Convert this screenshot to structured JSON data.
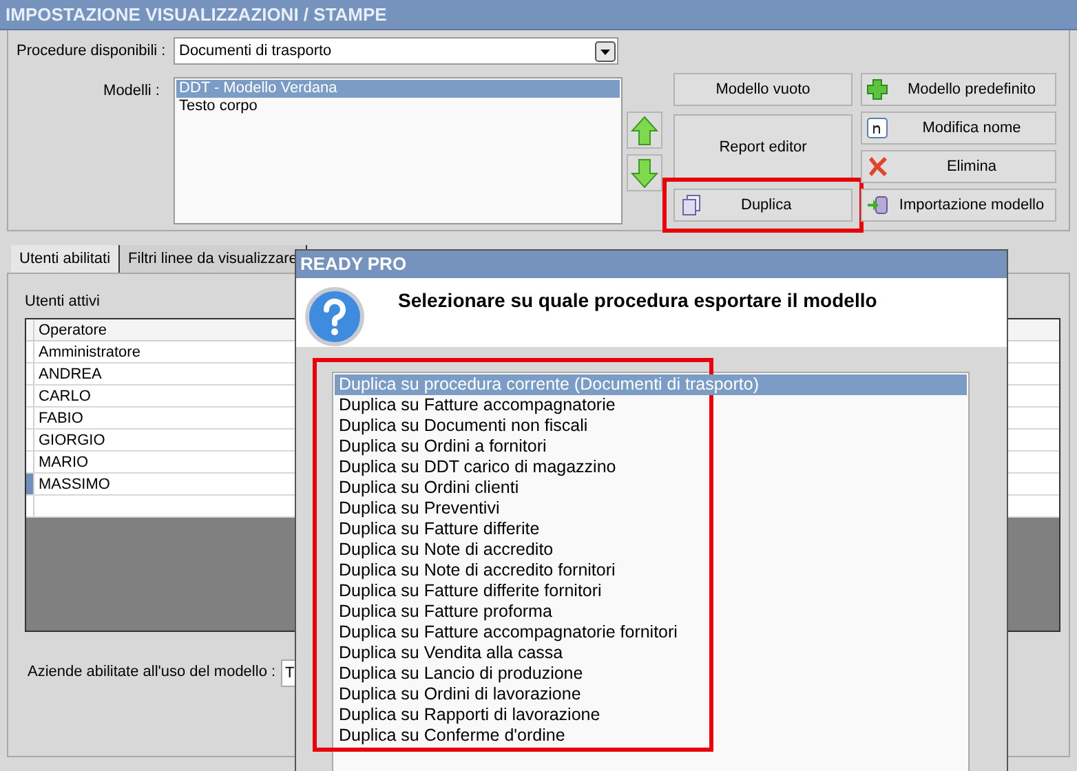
{
  "window": {
    "title": "IMPOSTAZIONE VISUALIZZAZIONI / STAMPE"
  },
  "procedure": {
    "label": "Procedure disponibili :",
    "value": "Documenti di trasporto"
  },
  "models": {
    "label": "Modelli :",
    "items": [
      {
        "text": "DDT - Modello Verdana",
        "selected": true
      },
      {
        "text": "Testo corpo",
        "selected": false
      }
    ]
  },
  "left_buttons": [
    {
      "label": "Modello vuoto",
      "kind": "plain"
    },
    {
      "label": "Report editor",
      "kind": "tall"
    },
    {
      "label": "Duplica",
      "kind": "duplicate"
    }
  ],
  "right_buttons": [
    {
      "label": "Modello predefinito",
      "kind": "add"
    },
    {
      "label": "Modifica nome",
      "kind": "rename"
    },
    {
      "label": "Elimina",
      "kind": "delete"
    },
    {
      "label": "Importazione modello",
      "kind": "import"
    }
  ],
  "tabs": [
    {
      "label": "Utenti abilitati",
      "selected": true
    },
    {
      "label": "Filtri linee da visualizzare",
      "selected": false
    }
  ],
  "users": {
    "label": "Utenti attivi",
    "column": "Operatore",
    "rows": [
      {
        "name": "Amministratore",
        "selected": false
      },
      {
        "name": "ANDREA",
        "selected": false
      },
      {
        "name": "CARLO",
        "selected": false
      },
      {
        "name": "FABIO",
        "selected": false
      },
      {
        "name": "GIORGIO",
        "selected": false
      },
      {
        "name": "MARIO",
        "selected": false
      },
      {
        "name": "MASSIMO",
        "selected": true
      }
    ]
  },
  "companies": {
    "label": "Aziende abilitate all'uso del modello :",
    "value": "T"
  },
  "dialog": {
    "title": "READY PRO",
    "message": "Selezionare su quale procedura esportare il modello",
    "options": [
      {
        "text": "Duplica su procedura corrente (Documenti di trasporto)",
        "selected": true
      },
      {
        "text": "Duplica su Fatture accompagnatorie",
        "selected": false
      },
      {
        "text": "Duplica su Documenti non fiscali",
        "selected": false
      },
      {
        "text": "Duplica su Ordini a fornitori",
        "selected": false
      },
      {
        "text": "Duplica su DDT carico di magazzino",
        "selected": false
      },
      {
        "text": "Duplica su Ordini clienti",
        "selected": false
      },
      {
        "text": "Duplica su Preventivi",
        "selected": false
      },
      {
        "text": "Duplica su Fatture differite",
        "selected": false
      },
      {
        "text": "Duplica su Note di accredito",
        "selected": false
      },
      {
        "text": "Duplica su Note di accredito fornitori",
        "selected": false
      },
      {
        "text": "Duplica su Fatture differite fornitori",
        "selected": false
      },
      {
        "text": "Duplica su Fatture proforma",
        "selected": false
      },
      {
        "text": "Duplica su Fatture accompagnatorie fornitori",
        "selected": false
      },
      {
        "text": "Duplica su Vendita alla cassa",
        "selected": false
      },
      {
        "text": "Duplica su Lancio di produzione",
        "selected": false
      },
      {
        "text": "Duplica su Ordini di lavorazione",
        "selected": false
      },
      {
        "text": "Duplica su Rapporti di lavorazione",
        "selected": false
      },
      {
        "text": "Duplica su Conferme d'ordine",
        "selected": false
      }
    ]
  }
}
